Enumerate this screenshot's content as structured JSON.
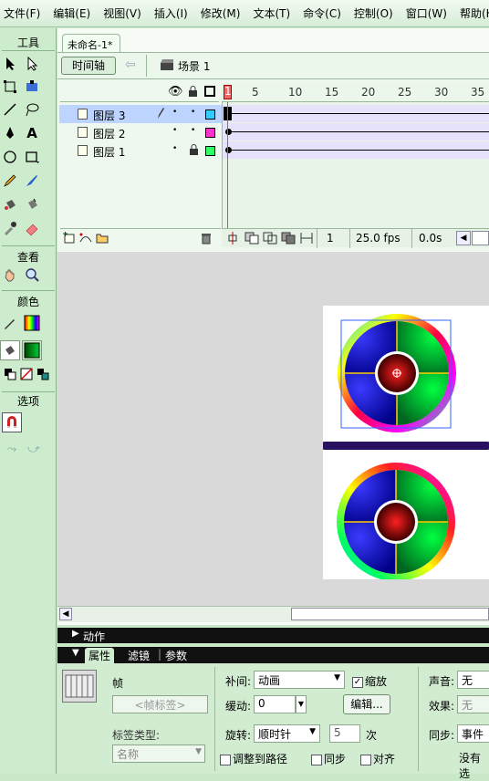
{
  "menubar": {
    "items": [
      "文件(F)",
      "编辑(E)",
      "视图(V)",
      "插入(I)",
      "修改(M)",
      "文本(T)",
      "命令(C)",
      "控制(O)",
      "窗口(W)",
      "帮助(H)"
    ]
  },
  "tools": {
    "section_tools": "工具",
    "section_view": "查看",
    "section_color": "颜色",
    "section_options": "选项"
  },
  "document": {
    "tab": "未命名-1*",
    "timeline_button": "时间轴",
    "scene": "场景 1"
  },
  "timeline": {
    "ruler": [
      "1",
      "5",
      "10",
      "15",
      "20",
      "25",
      "30",
      "35"
    ],
    "layers": [
      {
        "name": "图层 3",
        "selected": true,
        "outline_color": "#33ccff"
      },
      {
        "name": "图层 2",
        "selected": false,
        "outline_color": "#ff33cc"
      },
      {
        "name": "图层 1",
        "selected": false,
        "outline_color": "#33ff66"
      }
    ],
    "status": {
      "frame": "1",
      "fps": "25.0 fps",
      "time": "0.0s"
    }
  },
  "panels": {
    "actions": "动作",
    "tab_properties": "属性",
    "tab_filters": "滤镜",
    "tab_params": "参数"
  },
  "properties": {
    "frame_label": "帧",
    "frame_label_placeholder": "<帧标签>",
    "label_type_label": "标签类型:",
    "label_type_value": "名称",
    "tween_label": "补间:",
    "tween_value": "动画",
    "scale_label": "缩放",
    "ease_label": "缓动:",
    "ease_value": "0",
    "edit_button": "编辑...",
    "rotate_label": "旋转:",
    "rotate_value": "顺时针",
    "rotate_times": "5",
    "times_label": "次",
    "orient_path_label": "调整到路径",
    "sync_label": "同步",
    "snap_label": "对齐",
    "sound_label": "声音:",
    "sound_value": "无",
    "effect_label": "效果:",
    "effect_value": "无",
    "sync_sound_label": "同步:",
    "sync_sound_value": "事件",
    "no_sound_text": "没有选"
  },
  "colors": {
    "accent": "#2a1060",
    "selection": "#3366ff",
    "layer_selected_bg": "#bcd4ff"
  }
}
